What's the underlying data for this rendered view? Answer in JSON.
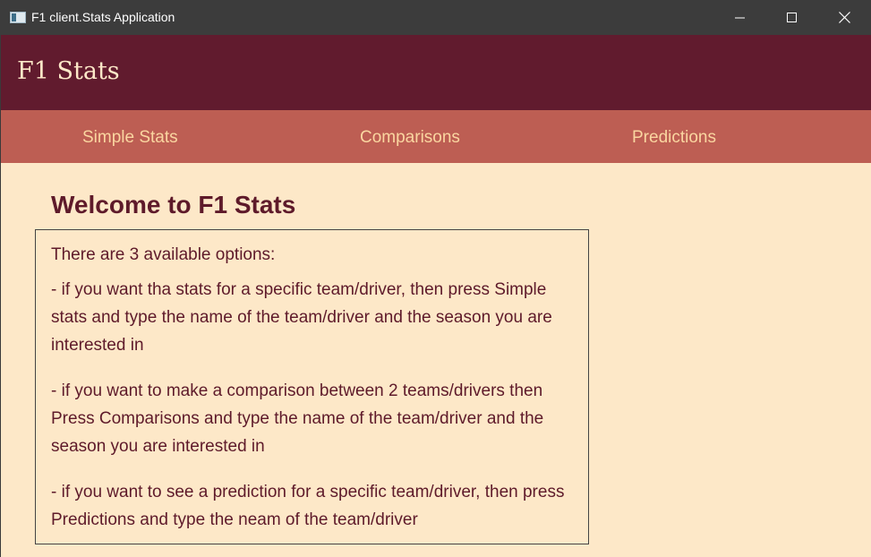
{
  "window": {
    "title": "F1 client.Stats Application",
    "icon": "app-window-icon"
  },
  "header": {
    "brand": "F1 Stats"
  },
  "nav": {
    "items": [
      {
        "label": "Simple Stats"
      },
      {
        "label": "Comparisons"
      },
      {
        "label": "Predictions"
      }
    ]
  },
  "main": {
    "heading": "Welcome to F1 Stats",
    "intro": "There are 3 available options:",
    "options": [
      "- if you want tha stats for a specific team/driver, then press Simple stats and type the name of the team/driver and the season you are interested in",
      "- if you want to make a comparison between 2 teams/drivers then Press Comparisons and type the name of the team/driver and the season you are interested in",
      "- if you want to see a prediction for a specific team/driver, then press Predictions and type the neam of the team/driver"
    ]
  },
  "colors": {
    "header_bg": "#611b2e",
    "nav_bg": "#bd5e53",
    "content_bg": "#fde8c8",
    "nav_text": "#fad6a0",
    "text": "#5e1a2a"
  }
}
